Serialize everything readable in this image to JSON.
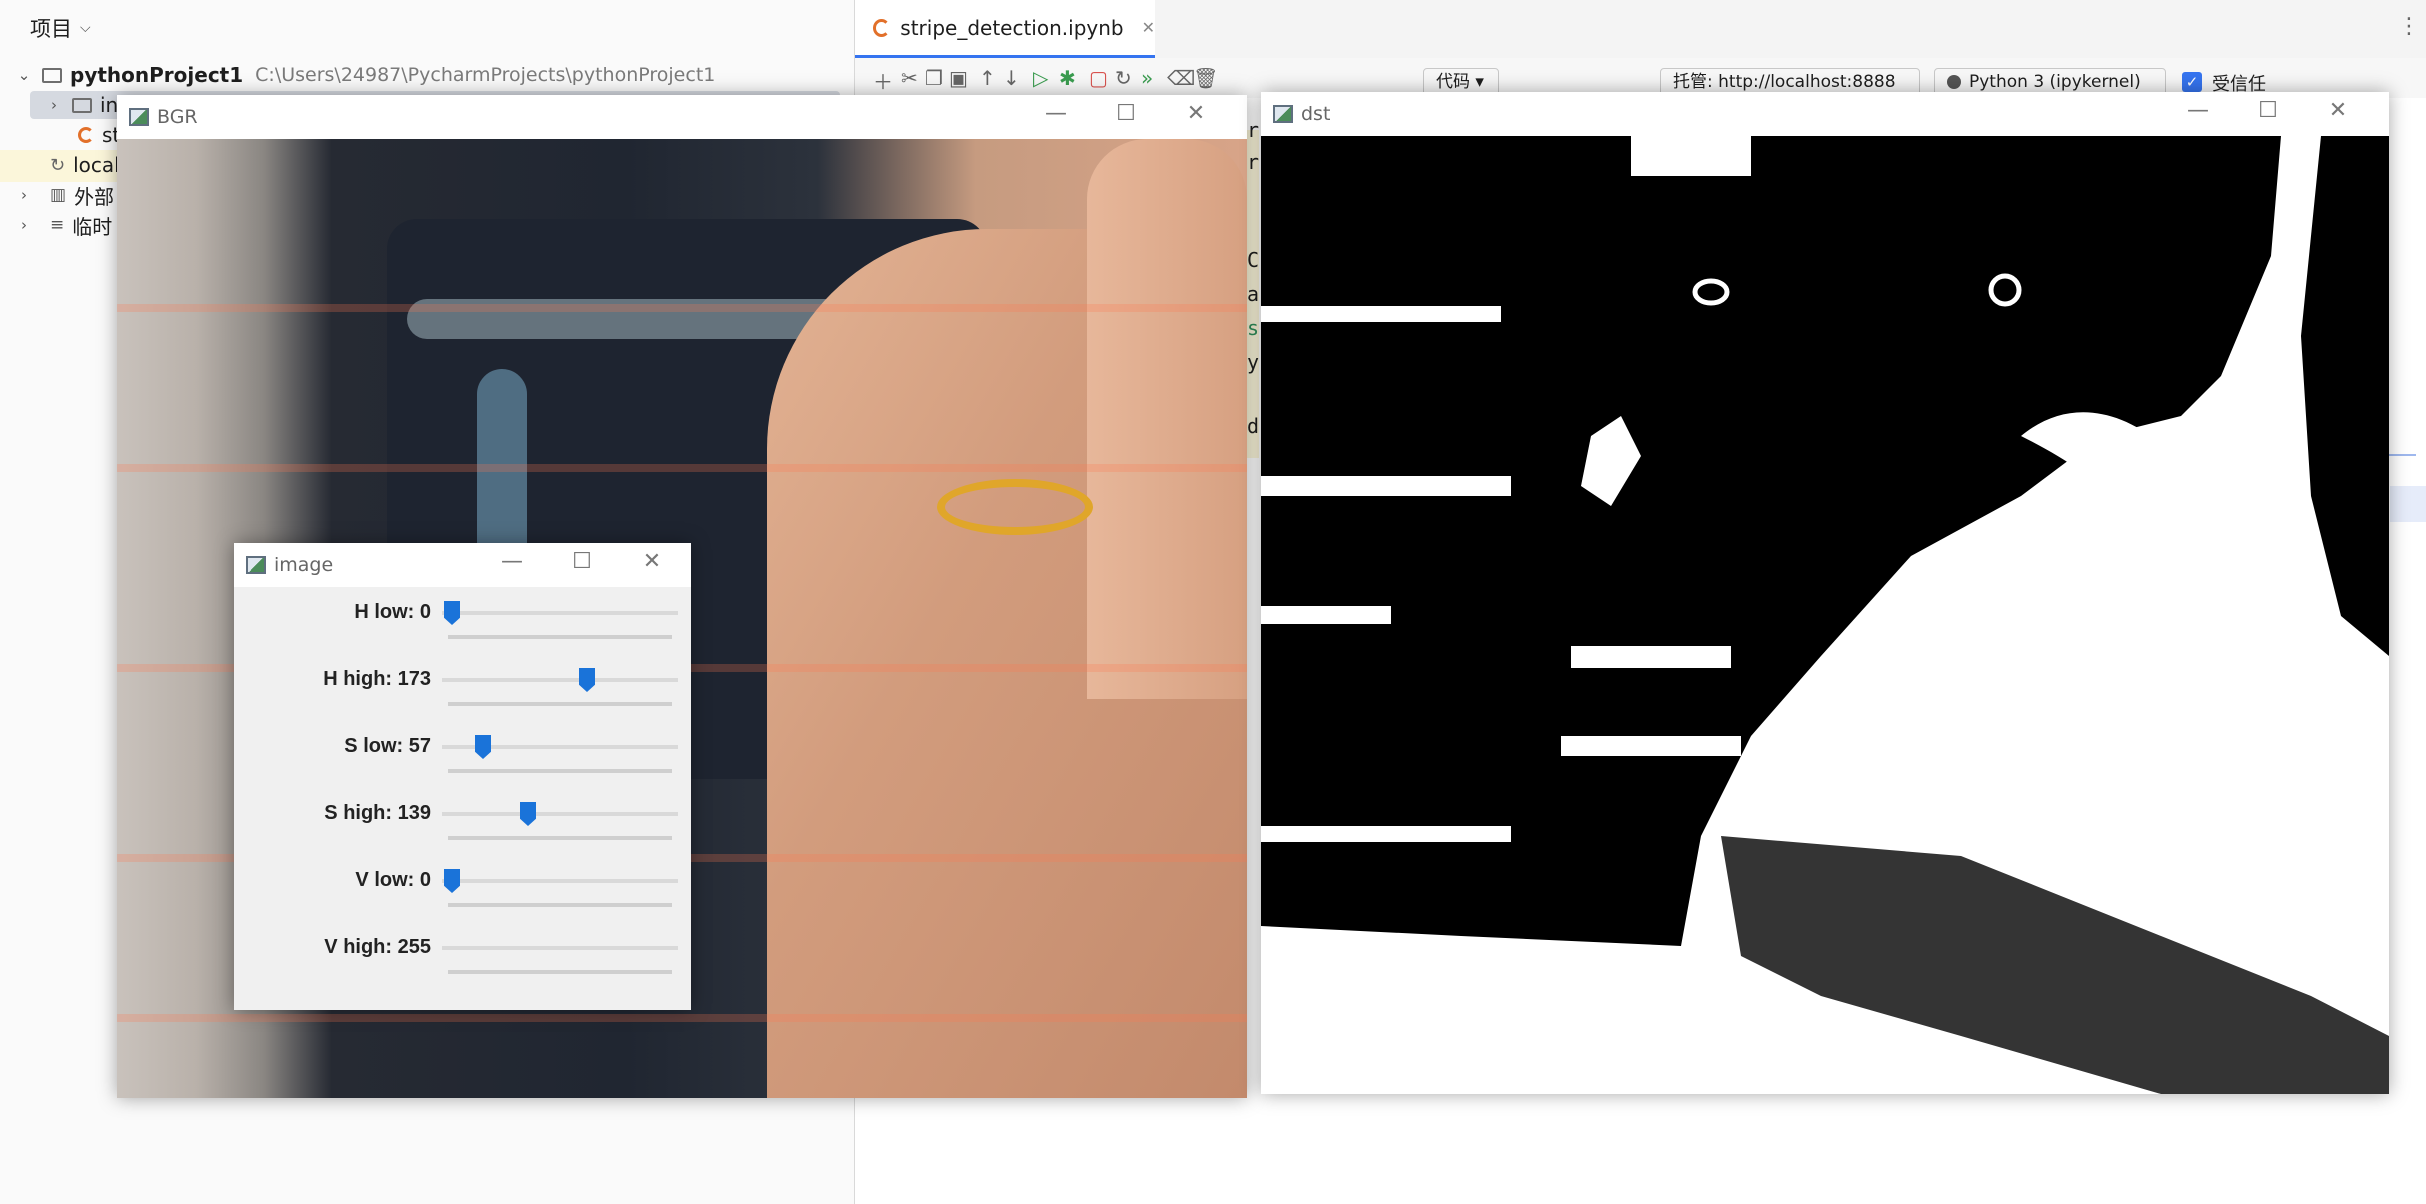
{
  "project": {
    "panel_title": "项目",
    "root_name": "pythonProject1",
    "root_path": "C:\\Users\\24987\\PycharmProjects\\pythonProject1",
    "child_folder": "in",
    "child_file": "st",
    "local_label": "local",
    "external_label": "外部",
    "scratch_label": "临时"
  },
  "editor": {
    "tab_label": "stripe_detection.ipynb",
    "cell_type": "代码",
    "server": "托管: http://localhost:8888",
    "kernel": "Python 3 (ipykernel)",
    "trusted_label": "受信任",
    "visible_code_chars": [
      "r",
      "r",
      "C",
      "a",
      "s",
      "y",
      "d"
    ]
  },
  "windows": {
    "bgr": {
      "title": "BGR"
    },
    "dst": {
      "title": "dst"
    },
    "trackbars": {
      "title": "image",
      "sliders": [
        {
          "label": "H low: 0",
          "value": 0,
          "max": 179
        },
        {
          "label": "H high: 173",
          "value": 173,
          "max": 179
        },
        {
          "label": "S low: 57",
          "value": 57,
          "max": 255
        },
        {
          "label": "S high: 139",
          "value": 139,
          "max": 255
        },
        {
          "label": "V low: 0",
          "value": 0,
          "max": 255
        },
        {
          "label": "V high: 255",
          "value": 255,
          "max": 255
        }
      ]
    }
  },
  "colors": {
    "accent": "#3574f0",
    "slider_thumb": "#1a73d9",
    "notebook_icon": "#e2702a"
  }
}
